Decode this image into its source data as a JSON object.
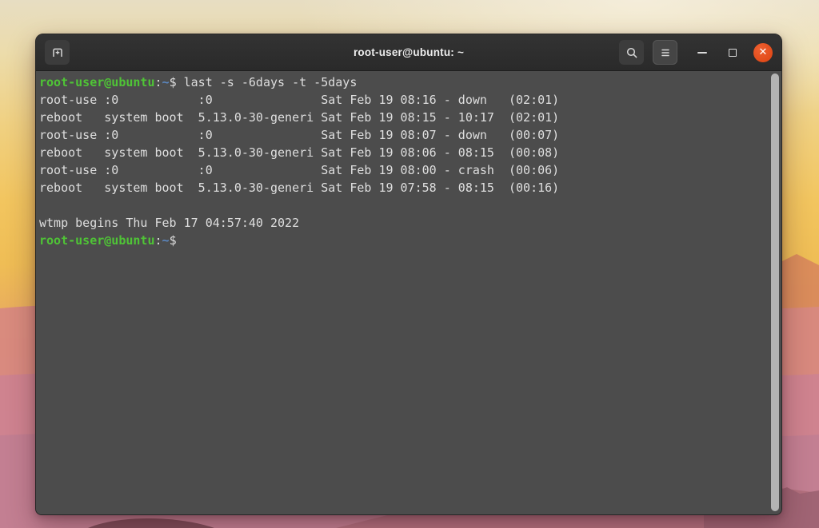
{
  "window": {
    "title": "root-user@ubuntu: ~"
  },
  "terminal": {
    "prompt": {
      "user": "root-user@ubuntu",
      "separator": ":",
      "path": "~",
      "symbol": "$"
    },
    "command": " last -s -6days -t -5days",
    "output_lines": [
      "root-use :0           :0               Sat Feb 19 08:16 - down   (02:01)",
      "reboot   system boot  5.13.0-30-generi Sat Feb 19 08:15 - 10:17  (02:01)",
      "root-use :0           :0               Sat Feb 19 08:07 - down   (00:07)",
      "reboot   system boot  5.13.0-30-generi Sat Feb 19 08:06 - 08:15  (00:08)",
      "root-use :0           :0               Sat Feb 19 08:00 - crash  (00:06)",
      "reboot   system boot  5.13.0-30-generi Sat Feb 19 07:58 - 08:15  (00:16)"
    ],
    "blank_line": " ",
    "wtmp_line": "wtmp begins Thu Feb 17 04:57:40 2022"
  },
  "icons": {
    "new_tab": "new-tab-icon",
    "search": "search-icon",
    "menu": "menu-icon",
    "minimize": "minimize-icon",
    "maximize": "maximize-icon",
    "close": "close-icon",
    "close_glyph": "✕"
  },
  "colors": {
    "terminal_bg": "#4c4c4c",
    "terminal_fg": "#dedede",
    "prompt_user_green": "#4fc436",
    "prompt_path_blue": "#5b87c0",
    "titlebar_bg": "#2e2e2e",
    "close_button_orange": "#e44f1d",
    "scrollbar": "#b4b4b4"
  }
}
